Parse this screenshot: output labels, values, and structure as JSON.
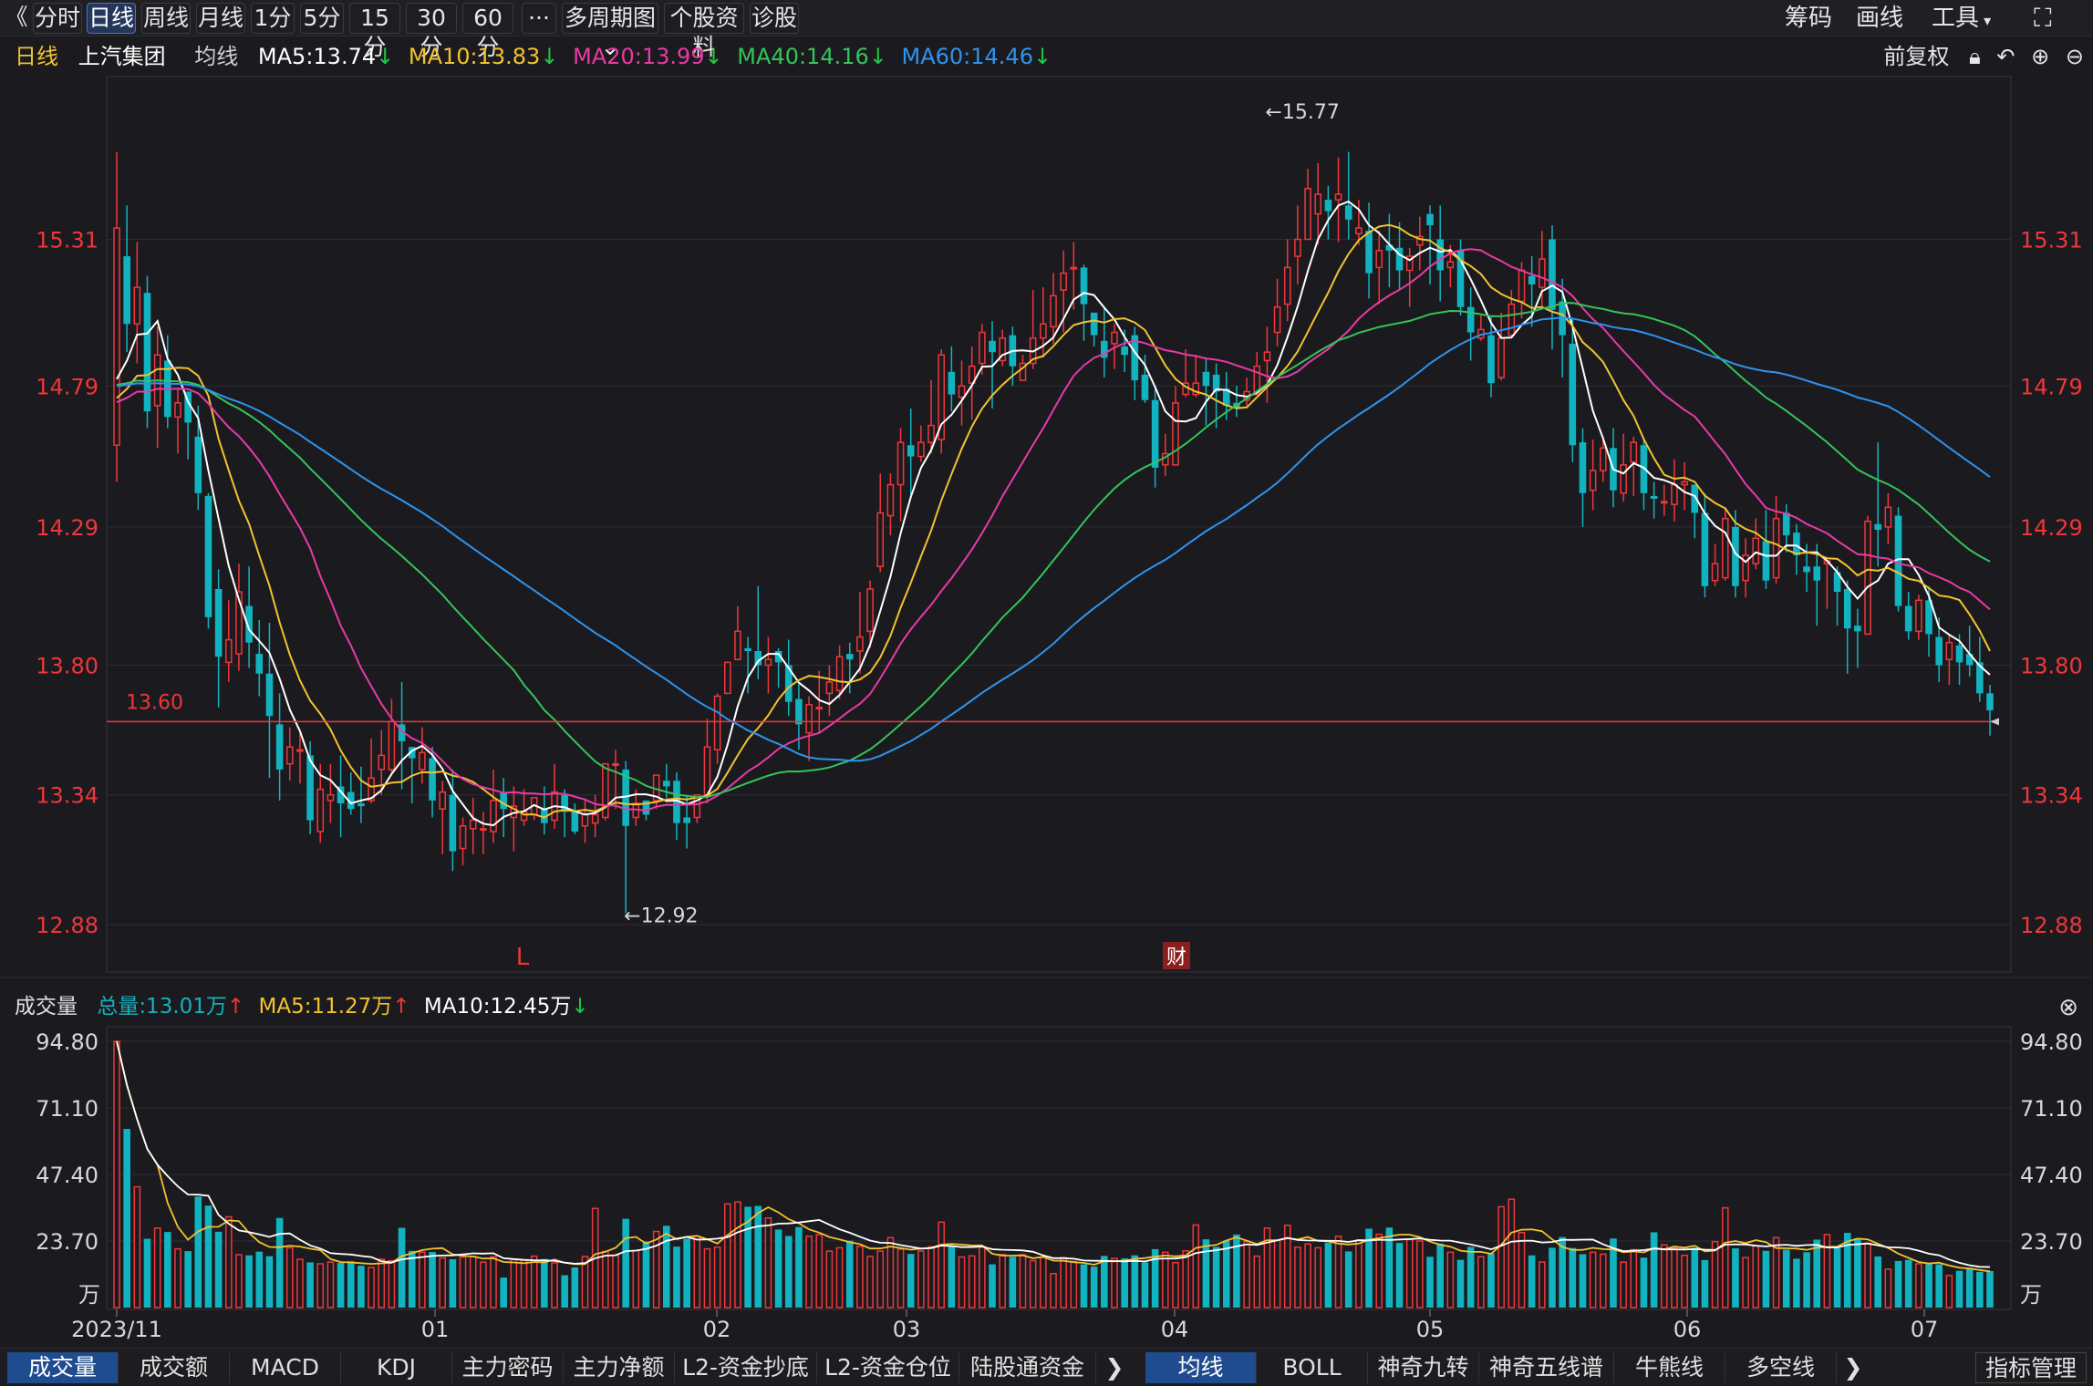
{
  "toolbar": {
    "back": "《",
    "periods": [
      "分时",
      "日线",
      "周线",
      "月线",
      "1分",
      "5分",
      "15分",
      "30分",
      "60分"
    ],
    "active_period": "日线",
    "more": "···",
    "multi_period": "多周期图",
    "profile": "个股资料",
    "diagnose": "诊股",
    "right": [
      "筹码",
      "画线",
      "工具"
    ]
  },
  "header": {
    "period": "日线",
    "stock": "上汽集团",
    "avg_label": "均线",
    "ma": [
      {
        "label": "MA5:13.74",
        "color": "#ffffff",
        "arrow": "down"
      },
      {
        "label": "MA10:13.83",
        "color": "#f2c230",
        "arrow": "down"
      },
      {
        "label": "MA20:13.99",
        "color": "#e83aa6",
        "arrow": "down"
      },
      {
        "label": "MA40:14.16",
        "color": "#35c35a",
        "arrow": "down"
      },
      {
        "label": "MA60:14.46",
        "color": "#2f93ef",
        "arrow": "down"
      }
    ],
    "adjust": "前复权"
  },
  "price_panel": {
    "y_ticks": [
      "15.31",
      "14.79",
      "14.29",
      "13.80",
      "13.34",
      "12.88"
    ],
    "high_marker": "←15.77",
    "low_marker": "←12.92",
    "ref_line": "13.60",
    "marker_L": "L",
    "marker_cai": "财"
  },
  "volume_panel": {
    "title": "成交量",
    "total": "总量:13.01万",
    "ma5": "MA5:11.27万",
    "ma10": "MA10:12.45万",
    "y_ticks": [
      "94.80",
      "71.10",
      "47.40",
      "23.70"
    ],
    "unit": "万"
  },
  "x_axis": [
    "2023/11",
    "01",
    "02",
    "03",
    "04",
    "05",
    "06",
    "07"
  ],
  "bottom_tabs_left": [
    "成交量",
    "成交额",
    "MACD",
    "KDJ",
    "主力密码",
    "主力净额",
    "L2-资金抄底",
    "L2-资金仓位",
    "陆股通资金"
  ],
  "bottom_tabs_right": [
    "均线",
    "BOLL",
    "神奇九转",
    "神奇五线谱",
    "牛熊线",
    "多空线"
  ],
  "indicator_manage": "指标管理",
  "colors": {
    "up": "#f0363a",
    "down": "#12b3c0",
    "bg": "#1b1b1f",
    "axis_text": "#f0363a"
  },
  "chart_data": {
    "type": "candlestick",
    "last": {
      "ma5": 13.74,
      "ma10": 13.83,
      "ma20": 13.99,
      "ma40": 14.16,
      "ma60": 14.46
    },
    "key_points": [
      {
        "date_index": 113,
        "label": "high",
        "value": 15.77
      },
      {
        "date_index": 50,
        "label": "low",
        "value": 12.92
      }
    ],
    "candles": [
      [
        14.58,
        15.35,
        14.45,
        15.62
      ],
      [
        15.25,
        15.01,
        14.91,
        15.43
      ],
      [
        15.01,
        15.14,
        14.87,
        15.3
      ],
      [
        15.12,
        14.7,
        14.64,
        15.18
      ],
      [
        14.72,
        14.9,
        14.57,
        15.0
      ],
      [
        14.88,
        14.68,
        14.64,
        14.97
      ],
      [
        14.68,
        14.73,
        14.55,
        14.78
      ],
      [
        14.77,
        14.66,
        14.53,
        14.77
      ],
      [
        14.61,
        14.41,
        14.35,
        14.72
      ],
      [
        14.4,
        13.97,
        13.93,
        14.41
      ],
      [
        14.07,
        13.83,
        13.65,
        14.14
      ],
      [
        13.81,
        13.89,
        13.74,
        14.03
      ],
      [
        13.84,
        14.06,
        13.78,
        14.16
      ],
      [
        14.01,
        13.88,
        13.79,
        14.15
      ],
      [
        13.84,
        13.77,
        13.69,
        13.96
      ],
      [
        13.77,
        13.62,
        13.4,
        13.95
      ],
      [
        13.59,
        13.43,
        13.32,
        13.7
      ],
      [
        13.45,
        13.51,
        13.39,
        13.58
      ],
      [
        13.5,
        13.5,
        13.38,
        13.56
      ],
      [
        13.48,
        13.25,
        13.2,
        13.53
      ],
      [
        13.21,
        13.36,
        13.17,
        13.45
      ],
      [
        13.32,
        13.34,
        13.24,
        13.45
      ],
      [
        13.37,
        13.31,
        13.19,
        13.48
      ],
      [
        13.35,
        13.29,
        13.27,
        13.42
      ],
      [
        13.31,
        13.3,
        13.24,
        13.44
      ],
      [
        13.32,
        13.4,
        13.31,
        13.54
      ],
      [
        13.43,
        13.48,
        13.34,
        13.57
      ],
      [
        13.43,
        13.6,
        13.42,
        13.68
      ],
      [
        13.59,
        13.53,
        13.36,
        13.74
      ],
      [
        13.51,
        13.47,
        13.31,
        13.51
      ],
      [
        13.43,
        13.49,
        13.38,
        13.58
      ],
      [
        13.47,
        13.32,
        13.26,
        13.51
      ],
      [
        13.29,
        13.35,
        13.13,
        13.39
      ],
      [
        13.34,
        13.14,
        13.07,
        13.43
      ],
      [
        13.15,
        13.23,
        13.09,
        13.26
      ],
      [
        13.22,
        13.25,
        13.13,
        13.33
      ],
      [
        13.22,
        13.22,
        13.13,
        13.28
      ],
      [
        13.21,
        13.32,
        13.17,
        13.43
      ],
      [
        13.35,
        13.29,
        13.19,
        13.4
      ],
      [
        13.26,
        13.3,
        13.14,
        13.37
      ],
      [
        13.25,
        13.28,
        13.23,
        13.36
      ],
      [
        13.27,
        13.33,
        13.25,
        13.33
      ],
      [
        13.29,
        13.24,
        13.2,
        13.37
      ],
      [
        13.25,
        13.35,
        13.22,
        13.45
      ],
      [
        13.34,
        13.28,
        13.19,
        13.36
      ],
      [
        13.28,
        13.21,
        13.2,
        13.31
      ],
      [
        13.23,
        13.27,
        13.17,
        13.32
      ],
      [
        13.24,
        13.27,
        13.19,
        13.34
      ],
      [
        13.26,
        13.45,
        13.25,
        13.45
      ],
      [
        13.45,
        13.45,
        13.29,
        13.5
      ],
      [
        13.43,
        13.23,
        12.92,
        13.46
      ],
      [
        13.26,
        13.31,
        13.23,
        13.36
      ],
      [
        13.32,
        13.27,
        13.25,
        13.32
      ],
      [
        13.32,
        13.41,
        13.29,
        13.41
      ],
      [
        13.39,
        13.37,
        13.33,
        13.45
      ],
      [
        13.39,
        13.24,
        13.18,
        13.42
      ],
      [
        13.26,
        13.24,
        13.15,
        13.34
      ],
      [
        13.26,
        13.34,
        13.24,
        13.34
      ],
      [
        13.34,
        13.51,
        13.31,
        13.61
      ],
      [
        13.5,
        13.69,
        13.45,
        13.7
      ],
      [
        13.7,
        13.81,
        13.71,
        13.8
      ],
      [
        13.82,
        13.92,
        13.83,
        14.01
      ],
      [
        13.86,
        13.85,
        13.7,
        13.9
      ],
      [
        13.85,
        13.8,
        13.75,
        14.08
      ],
      [
        13.8,
        13.82,
        13.7,
        13.9
      ],
      [
        13.85,
        13.81,
        13.72,
        13.86
      ],
      [
        13.8,
        13.67,
        13.62,
        13.89
      ],
      [
        13.68,
        13.59,
        13.5,
        13.74
      ],
      [
        13.56,
        13.66,
        13.46,
        13.69
      ],
      [
        13.65,
        13.65,
        13.56,
        13.78
      ],
      [
        13.7,
        13.74,
        13.62,
        13.8
      ],
      [
        13.71,
        13.83,
        13.68,
        13.87
      ],
      [
        13.84,
        13.82,
        13.7,
        13.88
      ],
      [
        13.85,
        13.9,
        13.77,
        14.06
      ],
      [
        13.92,
        14.07,
        13.86,
        14.1
      ],
      [
        14.15,
        14.34,
        14.13,
        14.48
      ],
      [
        14.33,
        14.44,
        14.26,
        14.48
      ],
      [
        14.44,
        14.59,
        14.31,
        14.64
      ],
      [
        14.58,
        14.54,
        14.39,
        14.71
      ],
      [
        14.54,
        14.59,
        14.52,
        14.65
      ],
      [
        14.59,
        14.65,
        14.55,
        14.81
      ],
      [
        14.6,
        14.9,
        14.55,
        14.92
      ],
      [
        14.84,
        14.76,
        14.7,
        14.93
      ],
      [
        14.75,
        14.79,
        14.65,
        14.88
      ],
      [
        14.8,
        14.86,
        14.67,
        14.93
      ],
      [
        14.87,
        14.98,
        14.83,
        15.01
      ],
      [
        14.95,
        14.91,
        14.71,
        15.02
      ],
      [
        14.88,
        14.96,
        14.86,
        14.99
      ],
      [
        14.97,
        14.86,
        14.79,
        15.0
      ],
      [
        14.81,
        14.87,
        14.81,
        14.9
      ],
      [
        14.87,
        14.96,
        14.85,
        15.13
      ],
      [
        14.96,
        15.01,
        14.89,
        15.14
      ],
      [
        15.0,
        15.11,
        14.94,
        15.19
      ],
      [
        15.13,
        15.19,
        14.98,
        15.27
      ],
      [
        15.21,
        15.21,
        15.06,
        15.3
      ],
      [
        15.21,
        15.08,
        14.95,
        15.22
      ],
      [
        15.05,
        14.97,
        14.93,
        15.04
      ],
      [
        14.95,
        14.89,
        14.82,
        15.07
      ],
      [
        14.94,
        14.98,
        14.85,
        15.01
      ],
      [
        14.93,
        14.9,
        14.84,
        14.99
      ],
      [
        14.97,
        14.81,
        14.74,
        15.0
      ],
      [
        14.83,
        14.74,
        14.73,
        14.9
      ],
      [
        14.74,
        14.5,
        14.43,
        14.79
      ],
      [
        14.51,
        14.55,
        14.47,
        14.62
      ],
      [
        14.51,
        14.73,
        14.56,
        14.79
      ],
      [
        14.76,
        14.8,
        14.75,
        14.92
      ],
      [
        14.76,
        14.8,
        14.75,
        14.9
      ],
      [
        14.84,
        14.79,
        14.65,
        14.89
      ],
      [
        14.83,
        14.77,
        14.64,
        14.87
      ],
      [
        14.78,
        14.72,
        14.67,
        14.84
      ],
      [
        14.73,
        14.71,
        14.68,
        14.79
      ],
      [
        14.74,
        14.77,
        14.72,
        14.82
      ],
      [
        14.76,
        14.86,
        14.76,
        14.91
      ],
      [
        14.88,
        14.91,
        14.73,
        15.0
      ],
      [
        14.98,
        15.07,
        14.93,
        15.17
      ],
      [
        15.08,
        15.21,
        15.02,
        15.31
      ],
      [
        15.25,
        15.31,
        15.15,
        15.43
      ],
      [
        15.31,
        15.49,
        15.31,
        15.56
      ],
      [
        15.4,
        15.47,
        15.29,
        15.58
      ],
      [
        15.45,
        15.41,
        15.31,
        15.5
      ],
      [
        15.45,
        15.47,
        15.3,
        15.6
      ],
      [
        15.43,
        15.38,
        15.31,
        15.62
      ],
      [
        15.33,
        15.35,
        15.29,
        15.45
      ],
      [
        15.34,
        15.19,
        15.1,
        15.44
      ],
      [
        15.21,
        15.27,
        15.08,
        15.34
      ],
      [
        15.29,
        15.27,
        15.14,
        15.4
      ],
      [
        15.28,
        15.2,
        15.13,
        15.37
      ],
      [
        15.2,
        15.25,
        15.07,
        15.28
      ],
      [
        15.29,
        15.32,
        15.2,
        15.39
      ],
      [
        15.4,
        15.36,
        15.15,
        15.43
      ],
      [
        15.31,
        15.2,
        15.09,
        15.43
      ],
      [
        15.21,
        15.23,
        15.14,
        15.29
      ],
      [
        15.27,
        15.07,
        15.04,
        15.31
      ],
      [
        15.07,
        14.98,
        14.88,
        15.14
      ],
      [
        14.96,
        14.99,
        14.95,
        15.04
      ],
      [
        14.97,
        14.8,
        14.75,
        15.04
      ],
      [
        14.82,
        14.96,
        14.81,
        15.05
      ],
      [
        14.97,
        15.08,
        14.96,
        15.13
      ],
      [
        15.09,
        15.2,
        15.03,
        15.23
      ],
      [
        15.18,
        15.15,
        15.0,
        15.25
      ],
      [
        15.14,
        15.24,
        15.07,
        15.34
      ],
      [
        15.31,
        15.06,
        14.92,
        15.36
      ],
      [
        15.09,
        14.97,
        14.82,
        15.17
      ],
      [
        14.94,
        14.58,
        14.52,
        15.03
      ],
      [
        14.59,
        14.41,
        14.29,
        14.64
      ],
      [
        14.42,
        14.49,
        14.35,
        14.6
      ],
      [
        14.49,
        14.57,
        14.45,
        14.61
      ],
      [
        14.57,
        14.42,
        14.36,
        14.64
      ],
      [
        14.41,
        14.51,
        14.38,
        14.62
      ],
      [
        14.52,
        14.59,
        14.4,
        14.61
      ],
      [
        14.58,
        14.41,
        14.35,
        14.6
      ],
      [
        14.4,
        14.39,
        14.32,
        14.45
      ],
      [
        14.38,
        14.38,
        14.33,
        14.44
      ],
      [
        14.37,
        14.44,
        14.31,
        14.53
      ],
      [
        14.44,
        14.45,
        14.35,
        14.52
      ],
      [
        14.44,
        14.34,
        14.25,
        14.43
      ],
      [
        14.34,
        14.08,
        14.04,
        14.41
      ],
      [
        14.1,
        14.16,
        14.08,
        14.23
      ],
      [
        14.11,
        14.32,
        14.1,
        14.36
      ],
      [
        14.29,
        14.08,
        14.04,
        14.35
      ],
      [
        14.1,
        14.19,
        14.04,
        14.25
      ],
      [
        14.16,
        14.25,
        14.14,
        14.32
      ],
      [
        14.24,
        14.1,
        14.07,
        14.35
      ],
      [
        14.11,
        14.32,
        14.09,
        14.4
      ],
      [
        14.34,
        14.26,
        14.2,
        14.37
      ],
      [
        14.27,
        14.19,
        14.12,
        14.3
      ],
      [
        14.15,
        14.13,
        14.06,
        14.23
      ],
      [
        14.15,
        14.1,
        13.94,
        14.23
      ],
      [
        14.16,
        14.17,
        14.0,
        14.17
      ],
      [
        14.13,
        14.06,
        13.94,
        14.15
      ],
      [
        14.07,
        13.93,
        13.77,
        14.1
      ],
      [
        13.94,
        13.92,
        13.79,
        14.0
      ],
      [
        13.91,
        14.31,
        13.92,
        14.33
      ],
      [
        14.3,
        14.28,
        14.15,
        14.59
      ],
      [
        14.29,
        14.36,
        14.23,
        14.41
      ],
      [
        14.33,
        14.01,
        13.99,
        14.36
      ],
      [
        14.01,
        13.92,
        13.89,
        14.06
      ],
      [
        13.92,
        14.03,
        13.89,
        14.05
      ],
      [
        14.03,
        13.91,
        13.83,
        14.08
      ],
      [
        13.9,
        13.8,
        13.74,
        13.97
      ],
      [
        13.82,
        13.88,
        13.73,
        13.91
      ],
      [
        13.87,
        13.81,
        13.73,
        13.91
      ],
      [
        13.84,
        13.8,
        13.76,
        13.94
      ],
      [
        13.81,
        13.7,
        13.67,
        13.9
      ],
      [
        13.7,
        13.64,
        13.55,
        13.73
      ]
    ],
    "volume": [
      94.8,
      63.6,
      43.0,
      24.5,
      28.3,
      26.9,
      20.9,
      20.1,
      39.5,
      36.3,
      27.0,
      32.3,
      18.8,
      18.6,
      19.9,
      18.3,
      31.9,
      21.3,
      17.2,
      16.1,
      15.6,
      16.2,
      15.9,
      16.5,
      14.9,
      14.3,
      17.2,
      16.7,
      28.4,
      20.2,
      19.7,
      19.8,
      17.7,
      17.2,
      18.0,
      18.2,
      16.2,
      18.1,
      10.7,
      17.1,
      16.9,
      18.3,
      17.3,
      15.9,
      11.5,
      14.3,
      18.2,
      35.3,
      20.0,
      18.6,
      31.6,
      20.3,
      23.5,
      27.1,
      29.1,
      21.7,
      24.5,
      25.4,
      20.9,
      21.5,
      36.9,
      37.6,
      35.9,
      36.2,
      31.9,
      27.8,
      25.5,
      28.7,
      25.4,
      26.0,
      20.1,
      21.3,
      23.8,
      21.8,
      18.2,
      20.1,
      24.9,
      20.8,
      19.1,
      20.1,
      21.6,
      30.4,
      22.1,
      18.0,
      18.4,
      21.8,
      15.4,
      18.9,
      18.1,
      18.8,
      16.7,
      17.9,
      12.1,
      17.8,
      16.4,
      15.4,
      14.6,
      18.4,
      17.5,
      17.5,
      18.6,
      16.1,
      20.8,
      19.7,
      16.0,
      20.2,
      29.4,
      24.3,
      21.6,
      23.8,
      26.0,
      23.5,
      18.3,
      28.3,
      23.9,
      29.3,
      21.5,
      22.6,
      21.3,
      23.1,
      25.4,
      20.0,
      24.1,
      28.1,
      26.1,
      28.5,
      23.0,
      24.2,
      23.7,
      18.1,
      22.8,
      19.7,
      17.0,
      21.6,
      18.1,
      19.3,
      35.9,
      38.6,
      26.7,
      18.6,
      16.2,
      21.3,
      25.1,
      21.2,
      19.0,
      19.7,
      19.0,
      24.6,
      16.2,
      20.6,
      17.8,
      26.8,
      22.3,
      21.1,
      18.6,
      21.3,
      16.9,
      23.5,
      35.5,
      21.1,
      17.8,
      22.0,
      20.2,
      24.9,
      20.6,
      17.4,
      19.7,
      24.2,
      26.0,
      21.2,
      26.6,
      24.7,
      22.9,
      18.2,
      13.7,
      16.6,
      17.0,
      15.6,
      15.5,
      15.4,
      11.4,
      13.1,
      14.2,
      12.7,
      13.0
    ]
  }
}
